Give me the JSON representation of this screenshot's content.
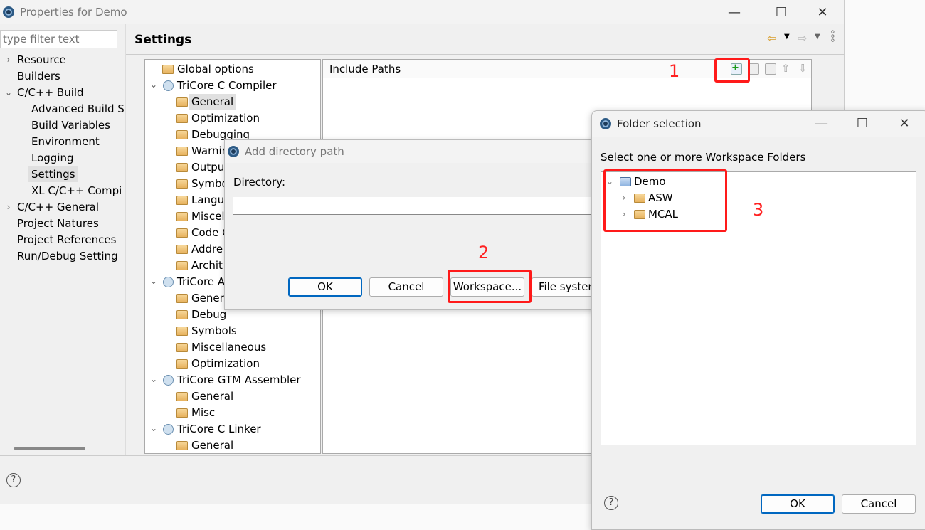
{
  "main_window": {
    "title": "Properties for Demo",
    "filter_placeholder": "type filter text",
    "header": "Settings",
    "nav": [
      {
        "label": "Resource",
        "chevron": "right",
        "level": 0
      },
      {
        "label": "Builders",
        "level": 0
      },
      {
        "label": "C/C++ Build",
        "chevron": "down",
        "level": 0
      },
      {
        "label": "Advanced Build S",
        "level": 1
      },
      {
        "label": "Build Variables",
        "level": 1
      },
      {
        "label": "Environment",
        "level": 1
      },
      {
        "label": "Logging",
        "level": 1
      },
      {
        "label": "Settings",
        "level": 1,
        "selected": true
      },
      {
        "label": "XL C/C++ Compi",
        "level": 1
      },
      {
        "label": "C/C++ General",
        "chevron": "right",
        "level": 0
      },
      {
        "label": "Project Natures",
        "level": 0
      },
      {
        "label": "Project References",
        "level": 0
      },
      {
        "label": "Run/Debug Setting",
        "level": 0
      }
    ],
    "tool_tree": [
      {
        "label": "Global options",
        "level": 0,
        "icon": "folder-settings-icon"
      },
      {
        "label": "TriCore C Compiler",
        "level": 0,
        "chevron": "down",
        "icon": "tool-icon"
      },
      {
        "label": "General",
        "level": 1,
        "selected": true
      },
      {
        "label": "Optimization",
        "level": 1
      },
      {
        "label": "Debugging",
        "level": 1
      },
      {
        "label": "Warnin",
        "level": 1
      },
      {
        "label": "Outpu",
        "level": 1
      },
      {
        "label": "Symbo",
        "level": 1
      },
      {
        "label": "Langua",
        "level": 1
      },
      {
        "label": "Miscel",
        "level": 1
      },
      {
        "label": "Code C",
        "level": 1
      },
      {
        "label": "Addre",
        "level": 1
      },
      {
        "label": "Archit",
        "level": 1
      },
      {
        "label": "TriCore A",
        "level": 0,
        "chevron": "down",
        "icon": "tool-icon"
      },
      {
        "label": "General",
        "level": 1
      },
      {
        "label": "Debug",
        "level": 1
      },
      {
        "label": "Symbols",
        "level": 1
      },
      {
        "label": "Miscellaneous",
        "level": 1
      },
      {
        "label": "Optimization",
        "level": 1
      },
      {
        "label": "TriCore GTM Assembler",
        "level": 0,
        "chevron": "down",
        "icon": "tool-icon"
      },
      {
        "label": "General",
        "level": 1
      },
      {
        "label": "Misc",
        "level": 1
      },
      {
        "label": "TriCore C Linker",
        "level": 0,
        "chevron": "down",
        "icon": "tool-icon"
      },
      {
        "label": "General",
        "level": 1
      }
    ],
    "include_paths_label": "Include Paths",
    "toolbar_icons": [
      "add-icon",
      "add-workspace-icon",
      "edit-icon",
      "move-up-icon",
      "move-down-icon"
    ]
  },
  "add_dir_dialog": {
    "title": "Add directory path",
    "directory_label": "Directory:",
    "directory_value": "",
    "ok": "OK",
    "cancel": "Cancel",
    "workspace": "Workspace...",
    "file_system": "File system"
  },
  "folder_dialog": {
    "title": "Folder selection",
    "prompt": "Select one or more Workspace Folders",
    "tree": [
      {
        "label": "Demo",
        "chevron": "down",
        "level": 0,
        "project": true
      },
      {
        "label": "ASW",
        "chevron": "right",
        "level": 1
      },
      {
        "label": "MCAL",
        "chevron": "right",
        "level": 1
      }
    ],
    "ok": "OK",
    "cancel": "Cancel"
  },
  "annotations": {
    "one": "1",
    "two": "2",
    "three": "3",
    "color": "#ff1a1a"
  }
}
